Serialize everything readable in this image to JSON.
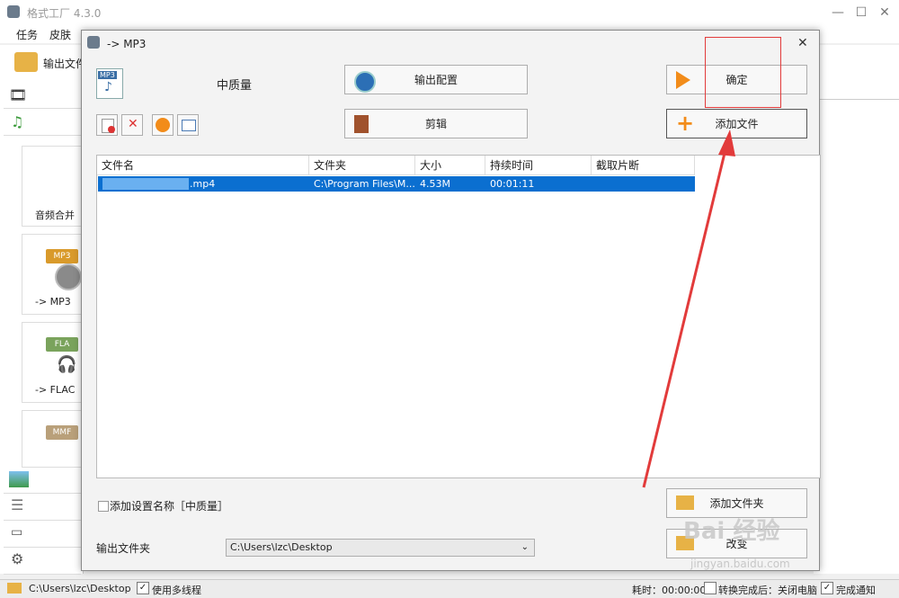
{
  "main_window": {
    "title": "格式工厂 4.3.0",
    "menu": [
      "任务",
      "皮肤"
    ],
    "toolbar_output_label": "输出文件",
    "tiles": [
      {
        "label": "音频合并",
        "badge": ""
      },
      {
        "label": "-> MP3",
        "badge": "MP3"
      },
      {
        "label": "-> FLAC",
        "badge": "FLA"
      },
      {
        "label": "",
        "badge": "MMF"
      }
    ]
  },
  "dialog": {
    "title": "-> MP3",
    "format_badge": "MP3",
    "quality": "中质量",
    "buttons": {
      "output_config": "输出配置",
      "clip": "剪辑",
      "ok": "确定",
      "add_file": "添加文件",
      "add_folder": "添加文件夹",
      "change": "改变"
    },
    "file_table": {
      "columns": [
        "文件名",
        "文件夹",
        "大小",
        "持续时间",
        "截取片断"
      ],
      "rows": [
        {
          "name": ".mp4",
          "folder": "C:\\Program Files\\M...",
          "size": "4.53M",
          "duration": "00:01:11",
          "clip": ""
        }
      ]
    },
    "add_settings_label": "添加设置名称［中质量］",
    "output_folder_label": "输出文件夹",
    "output_folder_value": "C:\\Users\\lzc\\Desktop"
  },
  "statusbar": {
    "path": "C:\\Users\\lzc\\Desktop",
    "multithread": "使用多线程",
    "elapsed": "耗时：00:00:00",
    "after_convert": "转换完成后：关闭电脑",
    "notify": "完成通知"
  },
  "watermark": {
    "text": "Bai 经验",
    "url": "jingyan.baidu.com"
  },
  "colors": {
    "accent": "#0b6fd0",
    "highlight_box": "#e23b3b",
    "arrow": "#e23b3b"
  }
}
